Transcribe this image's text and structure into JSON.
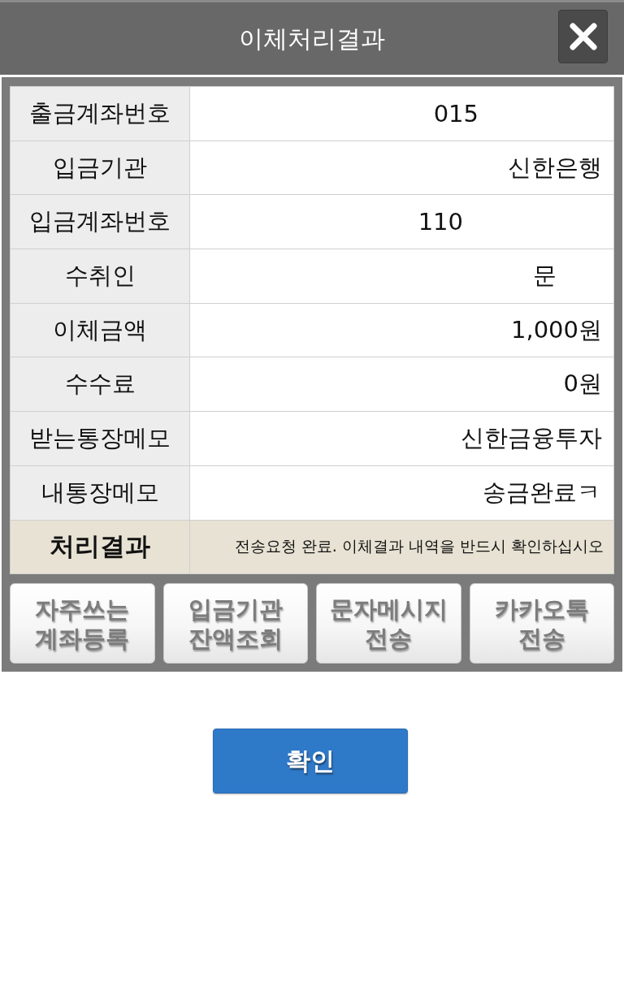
{
  "window": {
    "title": "이체처리결과"
  },
  "details": [
    {
      "kind": "field",
      "label": "출금계좌번호",
      "value": "015"
    },
    {
      "kind": "field",
      "label": "입금기관",
      "value": "신한은행"
    },
    {
      "kind": "field",
      "label": "입금계좌번호",
      "value": "110"
    },
    {
      "kind": "field",
      "label": "수취인",
      "value": "문"
    },
    {
      "kind": "field",
      "label": "이체금액",
      "value": "1,000원"
    },
    {
      "kind": "field",
      "label": "수수료",
      "value": "0원"
    },
    {
      "kind": "field",
      "label": "받는통장메모",
      "value": "신한금융투자"
    },
    {
      "kind": "field",
      "label": "내통장메모",
      "value": "송금완료ㅋ"
    },
    {
      "kind": "result",
      "label": "처리결과",
      "value": "전송요청 완료. 이체결과 내역을 반드시 확인하십시오"
    }
  ],
  "actions": [
    "자주쓰는\n계좌등록",
    "입금기관\n잔액조회",
    "문자메시지\n전송",
    "카카오톡\n전송"
  ],
  "confirm_button": "확인"
}
